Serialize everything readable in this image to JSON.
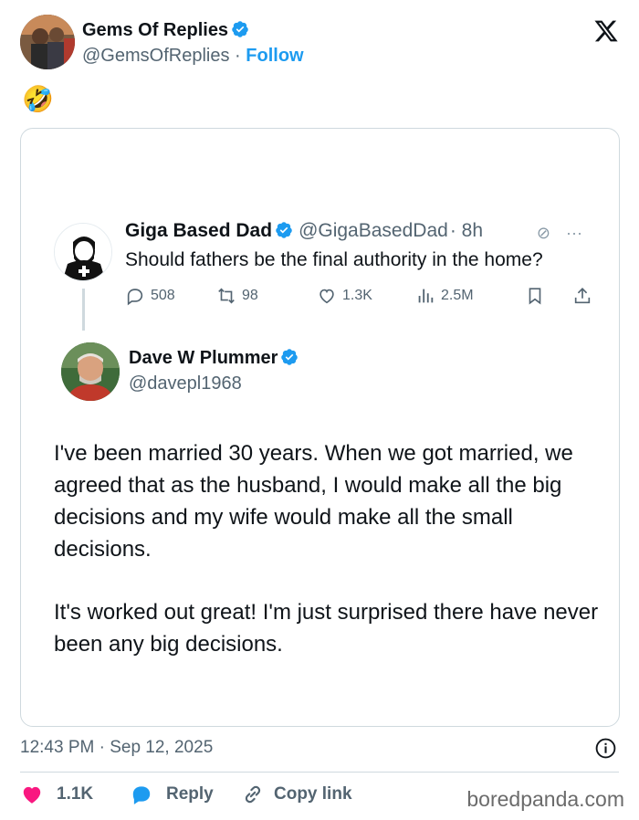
{
  "author": {
    "name": "Gems Of Replies",
    "handle": "@GemsOfReplies",
    "separator": "·",
    "follow_label": "Follow"
  },
  "emoji": "🤣",
  "quoted_tweet": {
    "author_name": "Giga Based Dad",
    "author_handle": "@GigaBasedDad",
    "age": "· 8h",
    "more": "···",
    "text": "Should fathers be the final authority in the home?",
    "metrics": {
      "replies": "508",
      "reposts": "98",
      "likes": "1.3K",
      "views": "2.5M"
    }
  },
  "reply_tweet": {
    "author_name": "Dave W Plummer",
    "author_handle": "@davepl1968",
    "paragraphs": [
      "I've been married 30 years.  When we got married, we agreed that as the husband, I would make all the big decisions and my wife would make all the small decisions.",
      "It's worked out great!  I'm just surprised there have never been any big decisions."
    ]
  },
  "footer": {
    "timestamp": "12:43 PM · Sep 12, 2025",
    "likes": "1.1K",
    "reply_label": "Reply",
    "copy_link_label": "Copy link",
    "watermark": "boredpanda.com"
  },
  "colors": {
    "accent": "#1d9bf0",
    "like": "#f91880",
    "text": "#0f1419",
    "secondary": "#536471",
    "border": "#cfd9de"
  }
}
